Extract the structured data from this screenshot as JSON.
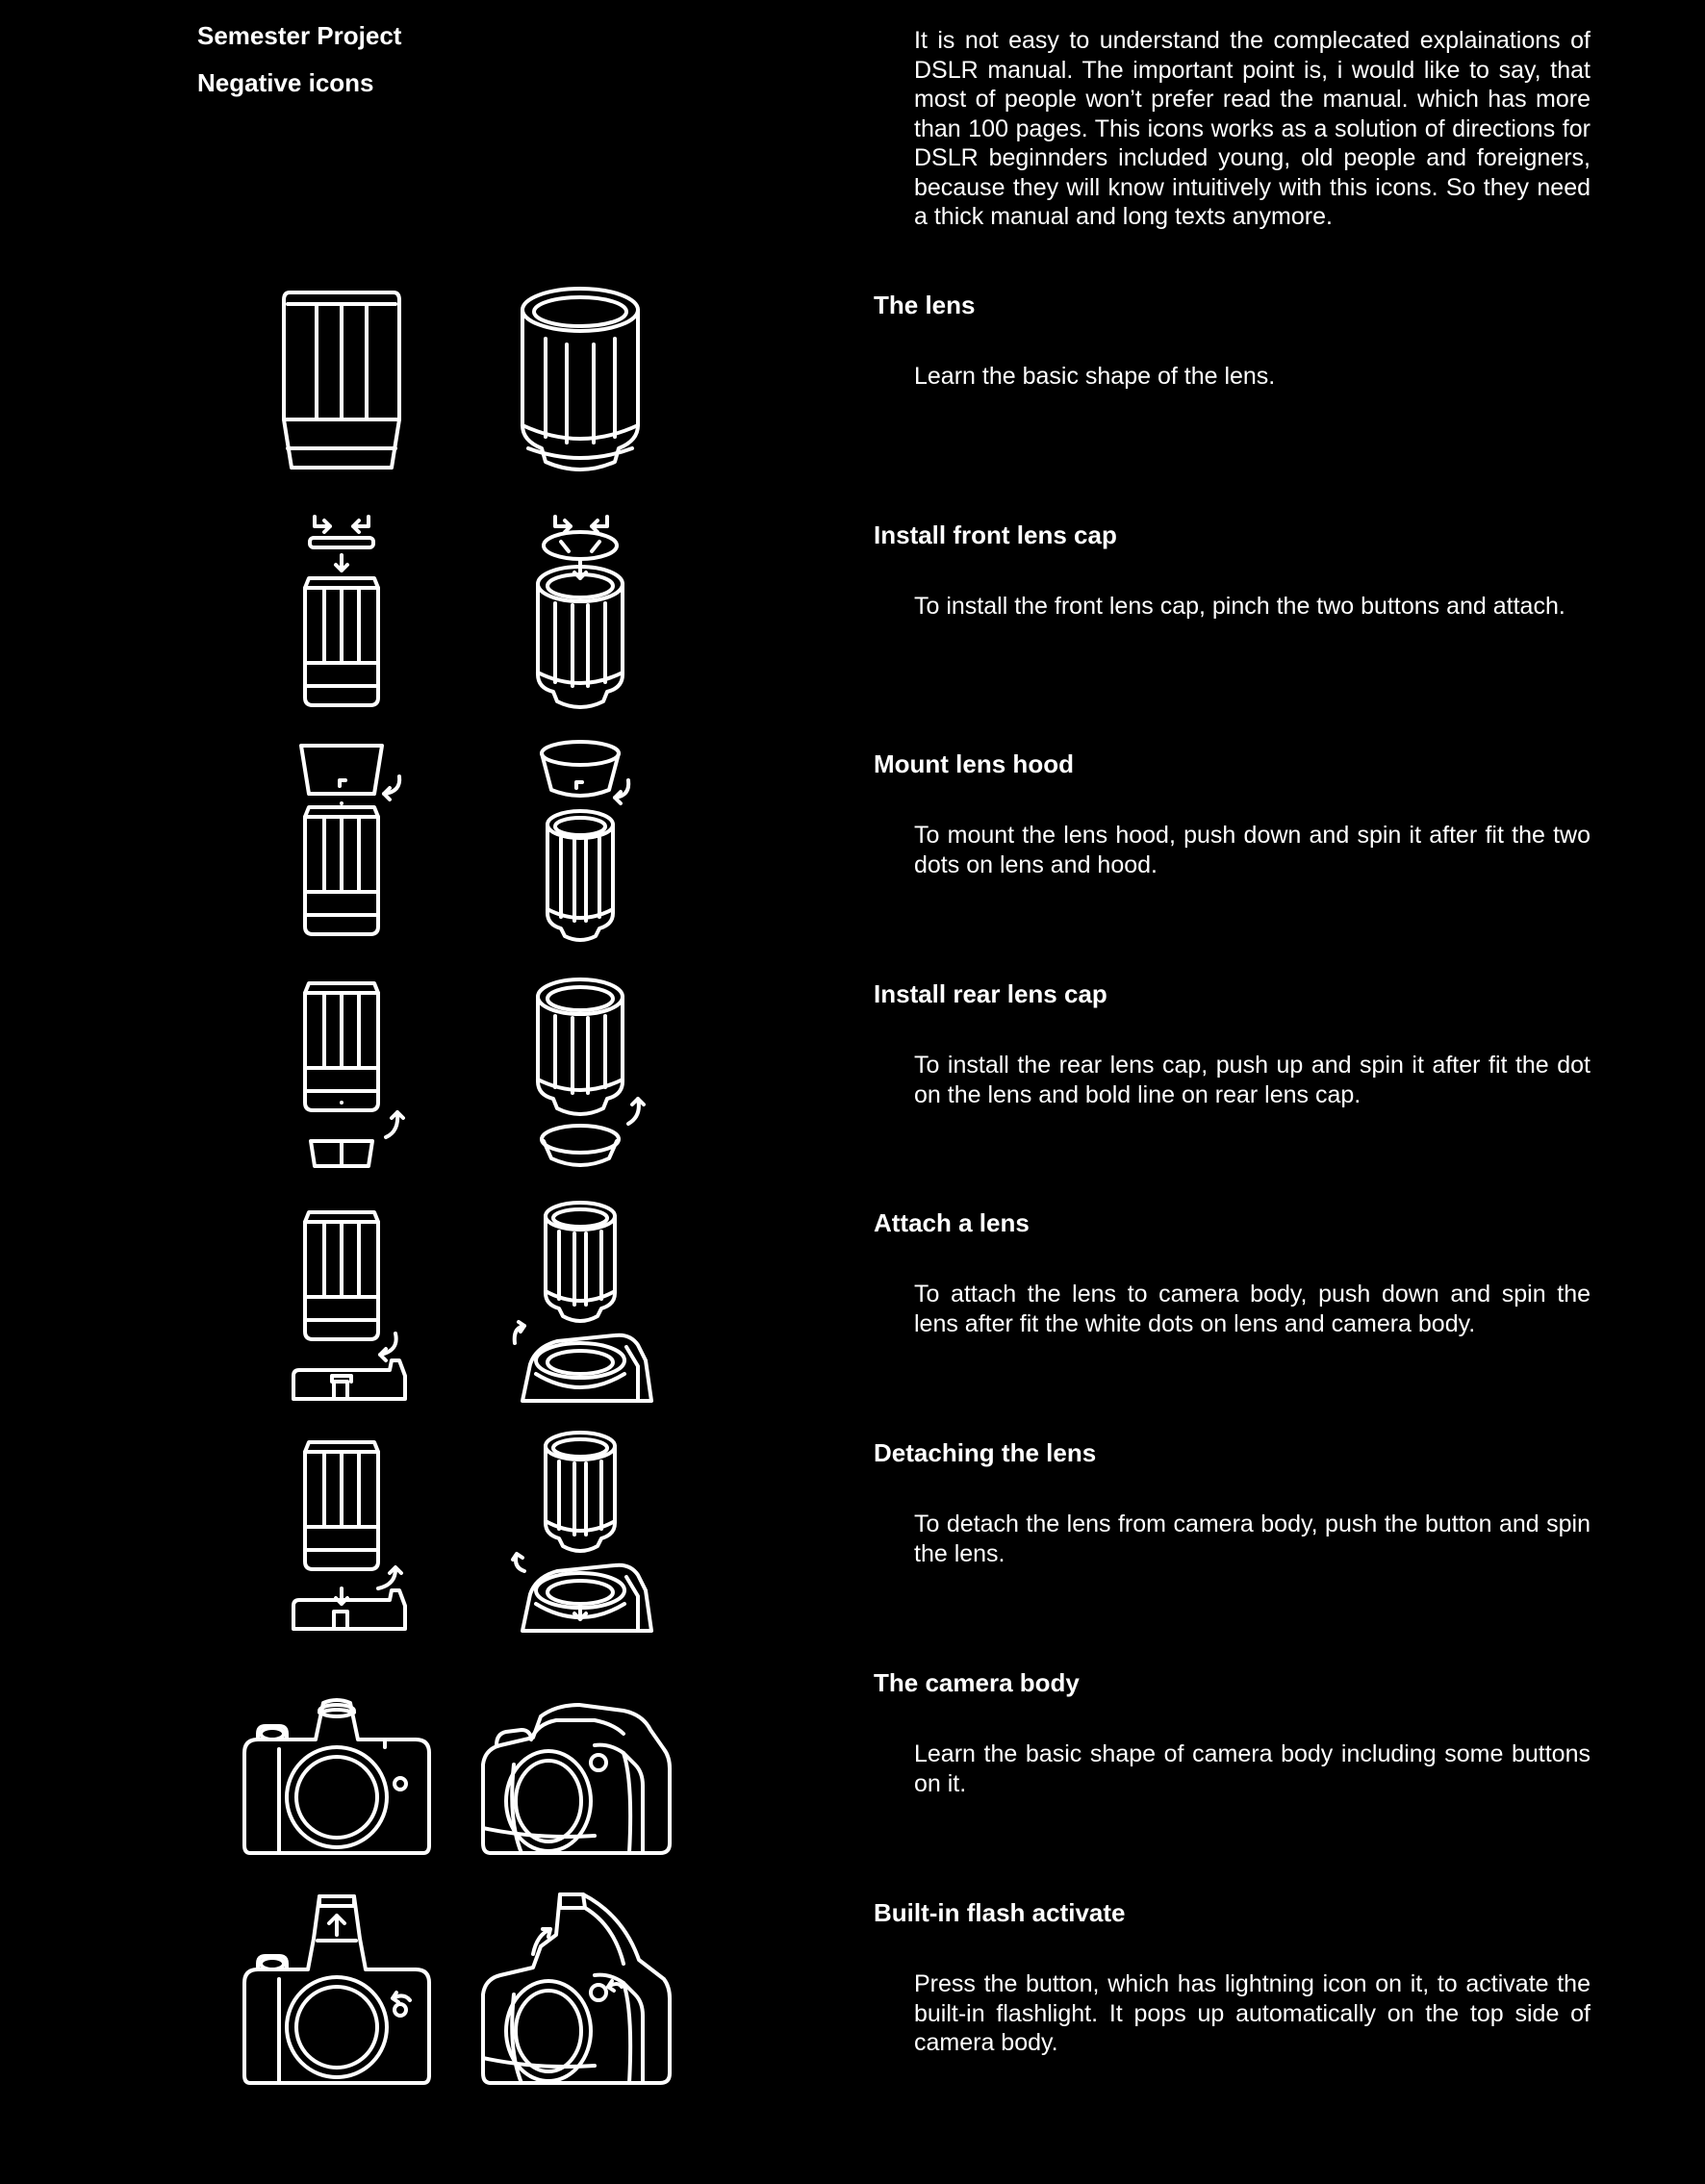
{
  "header": {
    "project_label": "Semester Project",
    "subtitle": "Negative icons"
  },
  "intro": {
    "text": "It is not easy to understand the complecated explainations of DSLR manual. The important point is, i would like to say, that most of people won’t prefer read the manual. which has more than 100 pages. This icons works as a solution of directions for DSLR beginnders included young, old people and foreigners, because they will know intuitively with this icons. So they need a thick manual and long texts anymore."
  },
  "sections": [
    {
      "title": "The lens",
      "description": "Learn the basic shape of the lens.",
      "icons": [
        "lens-flat-icon",
        "lens-iso-icon"
      ]
    },
    {
      "title": "Install front lens cap",
      "description": "To install the front lens cap, pinch the two buttons and attach.",
      "icons": [
        "front-cap-flat-icon",
        "front-cap-iso-icon"
      ]
    },
    {
      "title": "Mount lens hood",
      "description": "To mount the lens hood, push down and spin it after fit the two dots on lens and hood.",
      "icons": [
        "lens-hood-flat-icon",
        "lens-hood-iso-icon"
      ]
    },
    {
      "title": "Install rear lens cap",
      "description": "To install the rear lens cap, push up and spin it after fit the dot on the lens and bold line on rear lens cap.",
      "icons": [
        "rear-cap-flat-icon",
        "rear-cap-iso-icon"
      ]
    },
    {
      "title": "Attach a lens",
      "description": "To attach the lens to camera body, push down and spin the lens after fit the white dots on lens and camera body.",
      "icons": [
        "attach-lens-flat-icon",
        "attach-lens-iso-icon"
      ]
    },
    {
      "title": "Detaching the lens",
      "description": "To detach the lens from camera body, push the button and spin the lens.",
      "icons": [
        "detach-lens-flat-icon",
        "detach-lens-iso-icon"
      ]
    },
    {
      "title": "The camera body",
      "description": "Learn the basic shape of camera body including some buttons on it.",
      "icons": [
        "camera-body-front-icon",
        "camera-body-iso-icon"
      ]
    },
    {
      "title": "Built-in flash activate",
      "description": "Press the button, which has lightning icon on it, to activate the built-in flashlight. It pops up automatically on the top side of camera body.",
      "icons": [
        "flash-front-icon",
        "flash-iso-icon"
      ]
    }
  ],
  "colors": {
    "background": "#000000",
    "foreground": "#ffffff"
  }
}
